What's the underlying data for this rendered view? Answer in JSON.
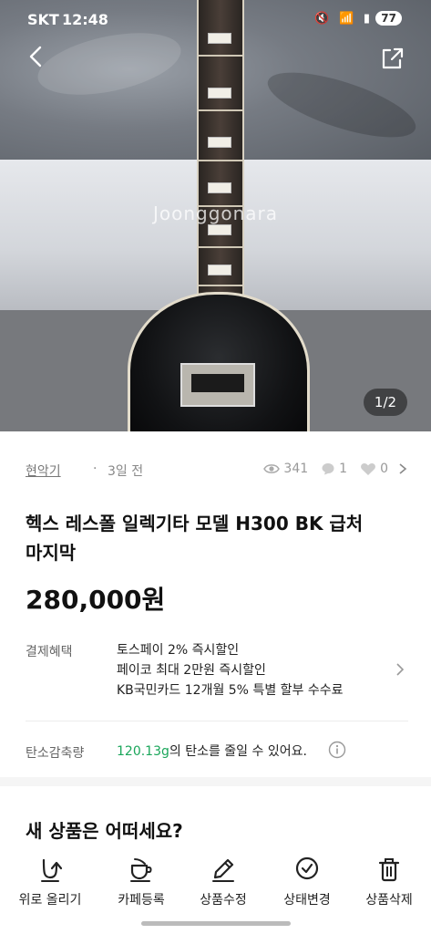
{
  "status_bar": {
    "carrier": "SKT",
    "time": "12:48",
    "icons": "🔇 📶 ▮",
    "battery": "77"
  },
  "hero": {
    "watermark": "Joonggonara",
    "pager": "1/2"
  },
  "meta": {
    "category": "현악기",
    "separator": "·",
    "time_ago": "3일 전",
    "views": "341",
    "chats": "1",
    "likes": "0"
  },
  "product": {
    "title_line1": "헥스 레스폴 일렉기타 모델 H300 BK 급처",
    "title_line2": "마지막",
    "price": "280,000원"
  },
  "payment": {
    "label": "결제혜택",
    "benefits": [
      "토스페이 2% 즉시할인",
      "페이코 최대 2만원 즉시할인",
      "KB국민카드 12개월 5% 특별 할부 수수료"
    ]
  },
  "carbon": {
    "label": "탄소감축량",
    "amount": "120.13g",
    "text": "의 탄소를 줄일 수 있어요."
  },
  "section": {
    "new_product_title": "새 상품은 어떠세요?"
  },
  "bottom_tabs": [
    {
      "label": "위로 올리기",
      "icon": "bump-up-icon"
    },
    {
      "label": "카페등록",
      "icon": "cafe-cup-icon"
    },
    {
      "label": "상품수정",
      "icon": "pencil-icon"
    },
    {
      "label": "상태변경",
      "icon": "check-circle-icon"
    },
    {
      "label": "상품삭제",
      "icon": "trash-icon"
    }
  ]
}
